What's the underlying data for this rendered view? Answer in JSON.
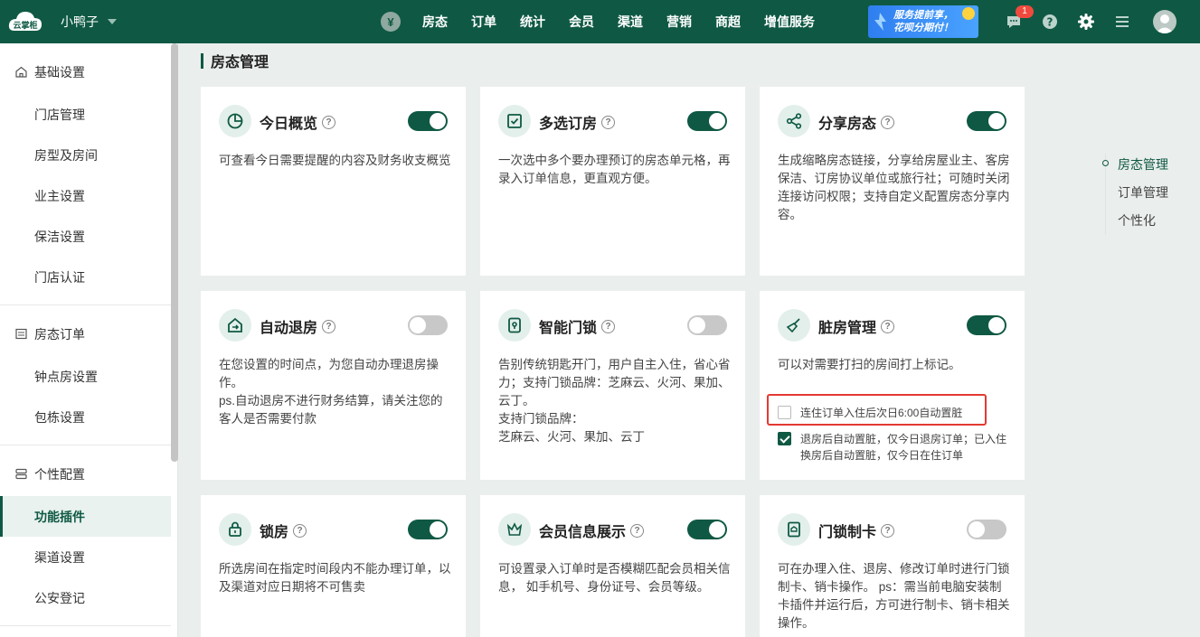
{
  "topbar": {
    "logo_text": "云掌柜",
    "store_name": "小鸭子",
    "nav": [
      "房态",
      "订单",
      "统计",
      "会员",
      "渠道",
      "营销",
      "商超",
      "增值服务"
    ],
    "promo_lines": [
      "服务提前享，",
      "花呗分期付！"
    ],
    "message_badge": "1",
    "coin_symbol": "¥"
  },
  "sidebar": {
    "groups": [
      {
        "label": "基础设置",
        "icon": "home-icon",
        "items": [
          "门店管理",
          "房型及房间",
          "业主设置",
          "保洁设置",
          "门店认证"
        ]
      },
      {
        "label": "房态订单",
        "icon": "list-icon",
        "items": [
          "钟点房设置",
          "包栋设置"
        ]
      },
      {
        "label": "个性配置",
        "icon": "config-icon",
        "items": [
          "功能插件",
          "渠道设置",
          "公安登记"
        ]
      }
    ],
    "active_item": "功能插件"
  },
  "page": {
    "title": "房态管理"
  },
  "cards": [
    {
      "title": "今日概览",
      "icon": "overview-pie-icon",
      "enabled": true,
      "desc": "可查看今日需要提醒的内容及财务收支概览"
    },
    {
      "title": "多选订房",
      "icon": "multi-select-icon",
      "enabled": true,
      "desc": "一次选中多个要办理预订的房态单元格，再录入订单信息，更直观方便。"
    },
    {
      "title": "分享房态",
      "icon": "share-icon",
      "enabled": true,
      "desc": "生成缩略房态链接，分享给房屋业主、客房保洁、订房协议单位或旅行社；可随时关闭连接访问权限；支持自定义配置房态分享内容。"
    },
    {
      "title": "自动退房",
      "icon": "auto-checkout-icon",
      "enabled": false,
      "desc": "在您设置的时间点，为您自动办理退房操作。\nps.自动退房不进行财务结算，请关注您的客人是否需要付款"
    },
    {
      "title": "智能门锁",
      "icon": "smart-lock-icon",
      "enabled": false,
      "desc": "告别传统钥匙开门，用户自主入住，省心省力；支持门锁品牌：芝麻云、火河、果加、云丁。\n支持门锁品牌：\n芝麻云、火河、果加、云丁"
    },
    {
      "title": "脏房管理",
      "icon": "broom-icon",
      "enabled": true,
      "desc": "可以对需要打扫的房间打上标记。",
      "options": [
        {
          "label": "连住订单入住后次日6:00自动置脏",
          "checked": false
        },
        {
          "label": "退房后自动置脏，仅今日退房订单；已入住换房后自动置脏，仅今日在住订单",
          "checked": true
        }
      ]
    },
    {
      "title": "锁房",
      "icon": "lock-icon",
      "enabled": true,
      "desc": "所选房间在指定时间段内不能办理订单，以及渠道对应日期将不可售卖"
    },
    {
      "title": "会员信息展示",
      "icon": "crown-icon",
      "enabled": true,
      "desc": "可设置录入订单时是否模糊匹配会员相关信息， 如手机号、身份证号、会员等级。"
    },
    {
      "title": "门锁制卡",
      "icon": "door-card-icon",
      "enabled": false,
      "desc": "可在办理入住、退房、修改订单时进行门锁制卡、销卡操作。 ps：需当前电脑安装制卡插件并运行后，方可进行制卡、销卡相关操作。"
    }
  ],
  "anchors": [
    "房态管理",
    "订单管理",
    "个性化"
  ],
  "colors": {
    "brand": "#0f5944",
    "highlight": "#e33a32",
    "toggle_off": "#c8c8c8"
  }
}
